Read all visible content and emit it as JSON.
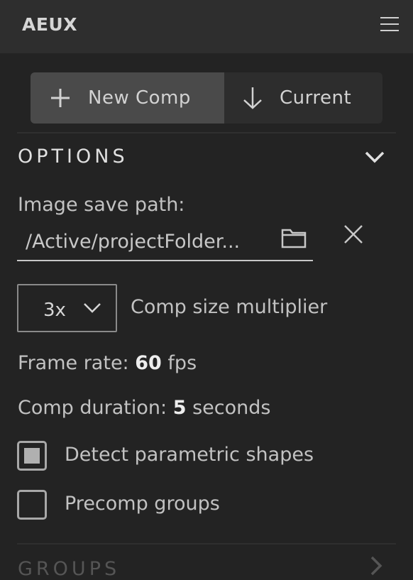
{
  "app": {
    "title": "AEUX"
  },
  "actions": {
    "new_comp_label": "New Comp",
    "current_label": "Current"
  },
  "options": {
    "title": "OPTIONS",
    "image_save_path_label": "Image save path:",
    "image_save_path_value": "/Active/projectFolder...",
    "multiplier": {
      "selected": "3x",
      "label": "Comp size multiplier"
    },
    "frame_rate": {
      "label": "Frame rate:",
      "value": "60",
      "unit": "fps"
    },
    "comp_duration": {
      "label": "Comp duration:",
      "value": "5",
      "unit": "seconds"
    },
    "checkboxes": [
      {
        "label": "Detect parametric shapes",
        "checked": true
      },
      {
        "label": "Precomp groups",
        "checked": false
      }
    ]
  },
  "groups": {
    "title": "GROUPS"
  },
  "icons": {
    "menu": "hamburger-menu-icon",
    "new_comp": "plus-icon",
    "current": "arrow-down-icon",
    "options_toggle": "chevron-down-icon",
    "folder": "folder-icon",
    "clear": "close-icon",
    "select_arrow": "chevron-down-icon",
    "groups_toggle": "chevron-right-icon"
  },
  "colors": {
    "background": "#232323",
    "header": "#2e2e2e",
    "primary_button": "#4a4a4a"
  }
}
